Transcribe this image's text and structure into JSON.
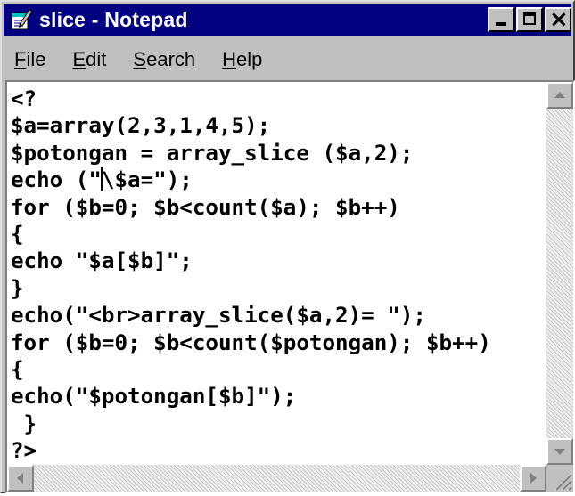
{
  "window": {
    "title": "slice - Notepad",
    "icon": "notepad-icon",
    "colors": {
      "titlebar": "#000080",
      "chrome": "#c0c0c0",
      "editor_bg": "#ffffff"
    }
  },
  "menu": [
    {
      "label": "File",
      "accel": "F",
      "rest": "ile"
    },
    {
      "label": "Edit",
      "accel": "E",
      "rest": "dit"
    },
    {
      "label": "Search",
      "accel": "S",
      "rest": "earch"
    },
    {
      "label": "Help",
      "accel": "H",
      "rest": "elp"
    }
  ],
  "editor": {
    "lines": [
      "<?",
      "$a=array(2,3,1,4,5);",
      "$potongan = array_slice ($a,2);",
      "echo (\"\\$a=\");",
      "for ($b=0; $b<count($a); $b++)",
      "{",
      "echo \"$a[$b]\";",
      "}",
      "echo(\"<br>array_slice($a,2)= \");",
      "for ($b=0; $b<count($potongan); $b++)",
      "{",
      "echo(\"$potongan[$b]\");",
      " }",
      "?>"
    ],
    "caret": {
      "line": 3,
      "column": 7
    }
  }
}
